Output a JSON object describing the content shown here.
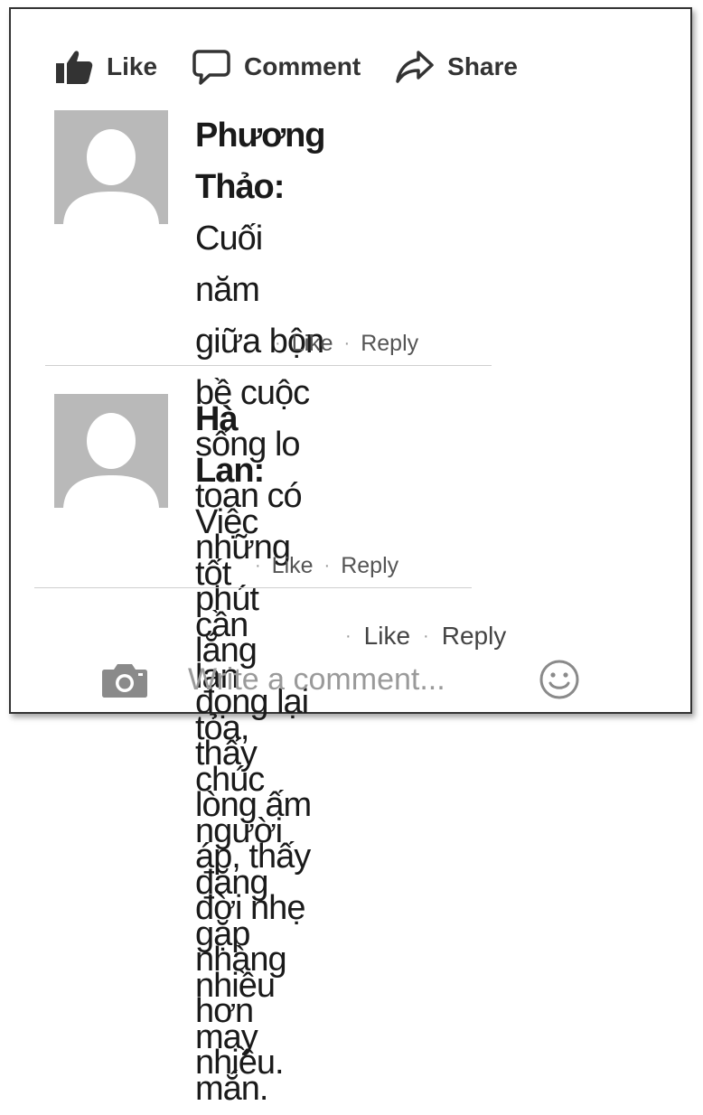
{
  "actions": {
    "like_label": "Like",
    "comment_label": "Comment",
    "share_label": "Share"
  },
  "comments": [
    {
      "author": "Phương Thảo:",
      "lines": [
        "Cuối năm giữa bộn",
        "bề cuộc sống lo toan có những",
        "phút lắng đọng lại thấy lòng ấm",
        "áp, thấy đời nhẹ nhàng hơn nhiều."
      ],
      "like_label": "Like",
      "reply_label": "Reply"
    },
    {
      "author": "Hà Lan:",
      "lines": [
        "Việc tốt cần lan tỏa,",
        "chúc người đăng gặp nhiều",
        "may mắn."
      ],
      "like_label": "Like",
      "reply_label": "Reply"
    }
  ],
  "post_meta": {
    "like_label": "Like",
    "reply_label": "Reply"
  },
  "composer": {
    "placeholder": "Write a comment...",
    "camera_icon": "camera-icon",
    "emoji_icon": "smiley-icon"
  }
}
